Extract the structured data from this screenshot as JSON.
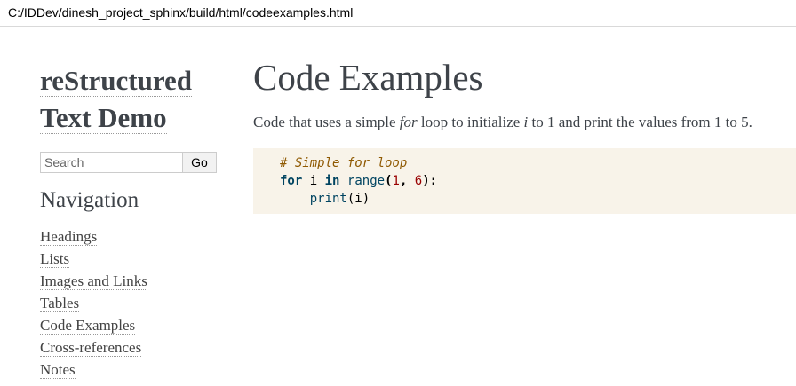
{
  "address_bar": {
    "url": "C:/IDDev/dinesh_project_sphinx/build/html/codeexamples.html"
  },
  "sidebar": {
    "logo_line1": "reStructured",
    "logo_line2": "Text Demo",
    "search": {
      "placeholder": "Search",
      "value": "",
      "button_label": "Go"
    },
    "nav_heading": "Navigation",
    "nav_items": [
      {
        "label": "Headings"
      },
      {
        "label": "Lists"
      },
      {
        "label": "Images and Links"
      },
      {
        "label": "Tables"
      },
      {
        "label": "Code Examples"
      },
      {
        "label": "Cross-references"
      },
      {
        "label": "Notes"
      }
    ]
  },
  "main": {
    "title": "Code Examples",
    "intro": {
      "part1": "Code that uses a simple ",
      "em1": "for",
      "part2": " loop to initialize ",
      "em2": "i",
      "part3": " to 1 and print the values from 1 to 5."
    },
    "code": {
      "comment": "# Simple for loop",
      "kw_for": "for",
      "var_i": "i",
      "kw_in": "in",
      "builtin_range": "range",
      "open_paren": "(",
      "num1": "1",
      "comma": ", ",
      "num6": "6",
      "close_colon": "):",
      "indent": "    ",
      "call_print": "print",
      "print_args": "(i)"
    }
  },
  "colors": {
    "text": "#3e4349",
    "code_bg": "#f8f3e9",
    "comment": "#8f5902",
    "keyword": "#004461",
    "number": "#990000"
  }
}
